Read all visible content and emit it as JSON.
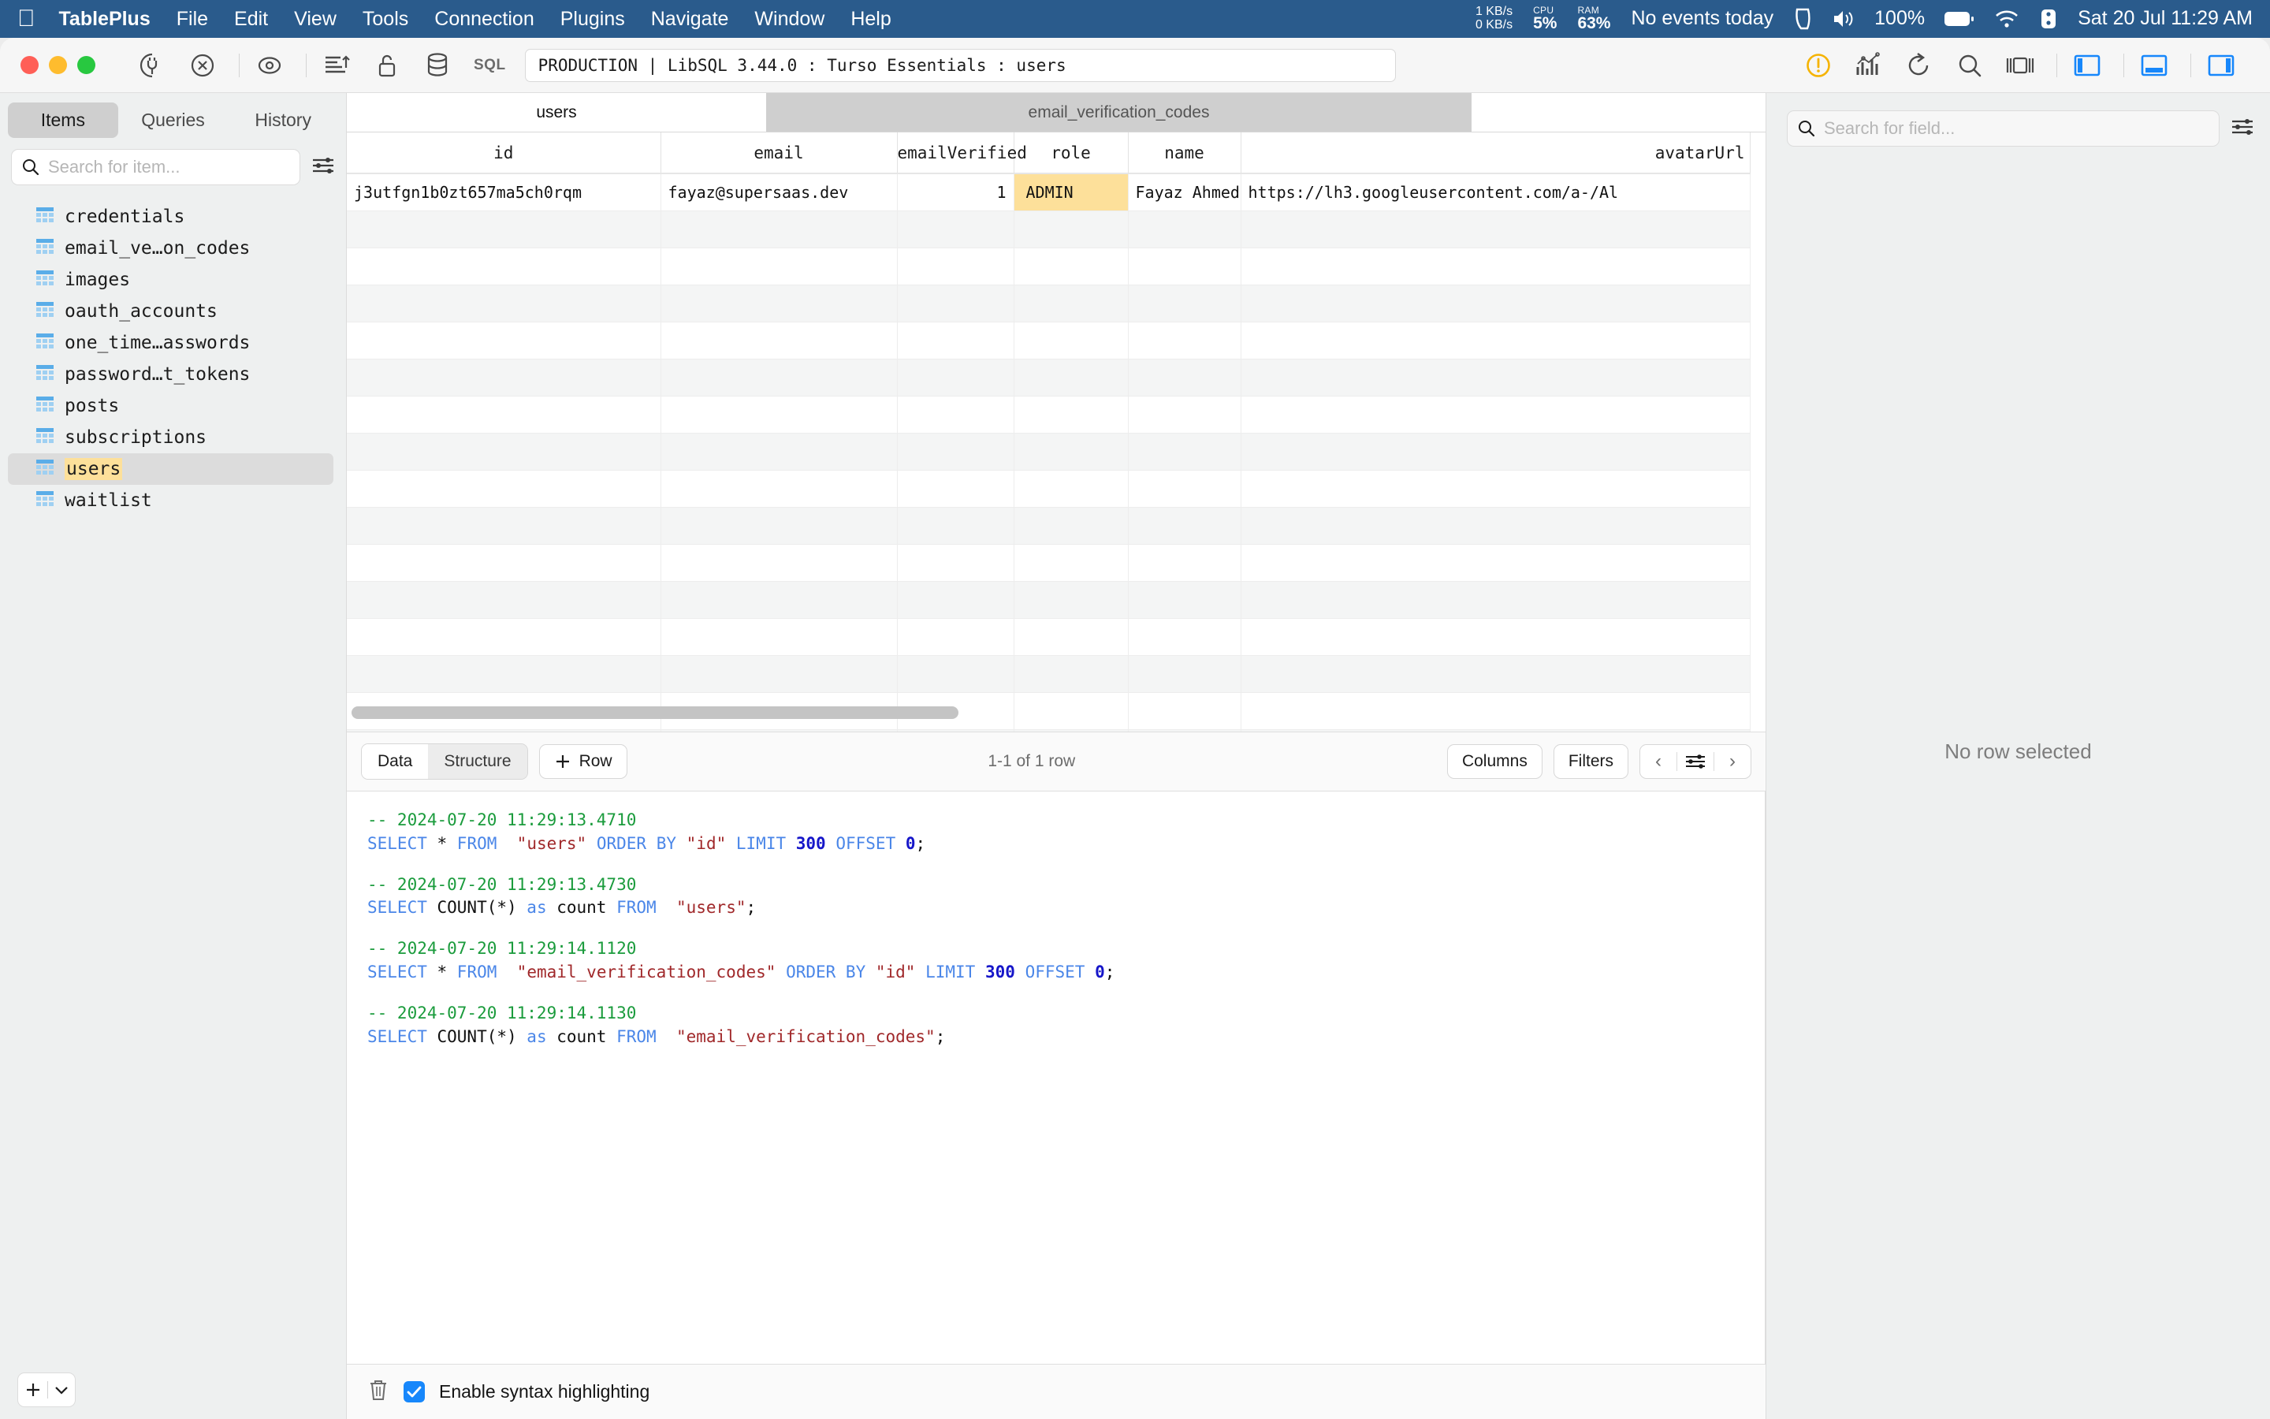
{
  "menubar": {
    "apple_icon": "apple-icon",
    "items": [
      "TablePlus",
      "File",
      "Edit",
      "View",
      "Tools",
      "Connection",
      "Plugins",
      "Navigate",
      "Window",
      "Help"
    ],
    "net_up": "1 KB/s",
    "net_down": "0 KB/s",
    "cpu_label": "CPU",
    "cpu_value": "5%",
    "ram_label": "RAM",
    "ram_value": "63%",
    "calendar": "No events today",
    "battery_percent": "100%",
    "clock": "Sat 20 Jul 11:29 AM"
  },
  "toolbar": {
    "sql_badge": "SQL",
    "connection_field": "PRODUCTION | LibSQL 3.44.0 : Turso Essentials : users",
    "icons_left": [
      "connect-plug-icon",
      "close-connection-icon",
      "eye-icon",
      "import-sort-icon",
      "lock-icon",
      "database-icon"
    ],
    "icons_right": [
      "warning-icon",
      "chart-icon",
      "refresh-icon",
      "search-icon",
      "layout-icon",
      "toggle-left-panel-icon",
      "toggle-bottom-panel-icon",
      "toggle-right-panel-icon"
    ]
  },
  "sidebar": {
    "tabs": [
      {
        "label": "Items",
        "active": true
      },
      {
        "label": "Queries",
        "active": false
      },
      {
        "label": "History",
        "active": false
      }
    ],
    "search_placeholder": "Search for item...",
    "search_value": "",
    "filter_icon": "sliders-icon",
    "items": [
      {
        "label": "credentials",
        "selected": false
      },
      {
        "label": "email_ve…on_codes",
        "selected": false
      },
      {
        "label": "images",
        "selected": false
      },
      {
        "label": "oauth_accounts",
        "selected": false
      },
      {
        "label": "one_time…asswords",
        "selected": false
      },
      {
        "label": "password…t_tokens",
        "selected": false
      },
      {
        "label": "posts",
        "selected": false
      },
      {
        "label": "subscriptions",
        "selected": false
      },
      {
        "label": "users",
        "selected": true
      },
      {
        "label": "waitlist",
        "selected": false
      }
    ],
    "add_button": "+",
    "add_dropdown_icon": "chevron-down-icon"
  },
  "data_tabs": [
    {
      "label": "users",
      "active": true
    },
    {
      "label": "email_verification_codes",
      "active": false
    }
  ],
  "grid": {
    "columns": [
      "id",
      "email",
      "emailVerified",
      "role",
      "name",
      "avatarUrl"
    ],
    "rows": [
      {
        "id": "j3utfgn1b0zt657ma5ch0rqm",
        "email": "fayaz@supersaas.dev",
        "emailVerified": "1",
        "role": "ADMIN",
        "name": "Fayaz Ahmed",
        "avatarUrl": "https://lh3.googleusercontent.com/a-/Al"
      }
    ],
    "highlight_color": "#fde09a",
    "empty_row_count": 16
  },
  "gridbar": {
    "data_label": "Data",
    "structure_label": "Structure",
    "add_row_label": "Row",
    "add_row_icon": "plus-icon",
    "row_count": "1-1 of 1 row",
    "columns_label": "Columns",
    "filters_label": "Filters",
    "prev_icon": "chevron-left-icon",
    "settings_icon": "sliders-icon",
    "next_icon": "chevron-right-icon"
  },
  "sql_log": [
    {
      "type": "comment",
      "text": "-- 2024-07-20 11:29:13.4710"
    },
    {
      "type": "sql",
      "tokens": [
        {
          "t": "SELECT",
          "c": "kw"
        },
        {
          "t": " * ",
          "c": "idt"
        },
        {
          "t": "FROM",
          "c": "kw"
        },
        {
          "t": "  ",
          "c": "idt"
        },
        {
          "t": "\"users\"",
          "c": "str"
        },
        {
          "t": " ",
          "c": "idt"
        },
        {
          "t": "ORDER BY",
          "c": "kw"
        },
        {
          "t": " ",
          "c": "idt"
        },
        {
          "t": "\"id\"",
          "c": "str"
        },
        {
          "t": " ",
          "c": "idt"
        },
        {
          "t": "LIMIT",
          "c": "kw"
        },
        {
          "t": " ",
          "c": "idt"
        },
        {
          "t": "300",
          "c": "numl"
        },
        {
          "t": " ",
          "c": "idt"
        },
        {
          "t": "OFFSET",
          "c": "kw"
        },
        {
          "t": " ",
          "c": "idt"
        },
        {
          "t": "0",
          "c": "numl"
        },
        {
          "t": ";",
          "c": "idt"
        }
      ]
    },
    {
      "type": "blank"
    },
    {
      "type": "comment",
      "text": "-- 2024-07-20 11:29:13.4730"
    },
    {
      "type": "sql",
      "tokens": [
        {
          "t": "SELECT",
          "c": "kw"
        },
        {
          "t": " COUNT(*) ",
          "c": "idt"
        },
        {
          "t": "as",
          "c": "kw"
        },
        {
          "t": " count ",
          "c": "idt"
        },
        {
          "t": "FROM",
          "c": "kw"
        },
        {
          "t": "  ",
          "c": "idt"
        },
        {
          "t": "\"users\"",
          "c": "str"
        },
        {
          "t": ";",
          "c": "idt"
        }
      ]
    },
    {
      "type": "blank"
    },
    {
      "type": "comment",
      "text": "-- 2024-07-20 11:29:14.1120"
    },
    {
      "type": "sql",
      "tokens": [
        {
          "t": "SELECT",
          "c": "kw"
        },
        {
          "t": " * ",
          "c": "idt"
        },
        {
          "t": "FROM",
          "c": "kw"
        },
        {
          "t": "  ",
          "c": "idt"
        },
        {
          "t": "\"email_verification_codes\"",
          "c": "str"
        },
        {
          "t": " ",
          "c": "idt"
        },
        {
          "t": "ORDER BY",
          "c": "kw"
        },
        {
          "t": " ",
          "c": "idt"
        },
        {
          "t": "\"id\"",
          "c": "str"
        },
        {
          "t": " ",
          "c": "idt"
        },
        {
          "t": "LIMIT",
          "c": "kw"
        },
        {
          "t": " ",
          "c": "idt"
        },
        {
          "t": "300",
          "c": "numl"
        },
        {
          "t": " ",
          "c": "idt"
        },
        {
          "t": "OFFSET",
          "c": "kw"
        },
        {
          "t": " ",
          "c": "idt"
        },
        {
          "t": "0",
          "c": "numl"
        },
        {
          "t": ";",
          "c": "idt"
        }
      ]
    },
    {
      "type": "blank"
    },
    {
      "type": "comment",
      "text": "-- 2024-07-20 11:29:14.1130"
    },
    {
      "type": "sql",
      "tokens": [
        {
          "t": "SELECT",
          "c": "kw"
        },
        {
          "t": " COUNT(*) ",
          "c": "idt"
        },
        {
          "t": "as",
          "c": "kw"
        },
        {
          "t": " count ",
          "c": "idt"
        },
        {
          "t": "FROM",
          "c": "kw"
        },
        {
          "t": "  ",
          "c": "idt"
        },
        {
          "t": "\"email_verification_codes\"",
          "c": "str"
        },
        {
          "t": ";",
          "c": "idt"
        }
      ]
    }
  ],
  "statusbar": {
    "trash_icon": "trash-icon",
    "checkbox_checked": true,
    "checkbox_label": "Enable syntax highlighting"
  },
  "right_panel": {
    "search_placeholder": "Search for field...",
    "filter_icon": "sliders-icon",
    "empty_message": "No row selected"
  },
  "colors": {
    "menubar_bg": "#2a5b8c",
    "accent_blue": "#1787fb",
    "highlight_yellow": "#fde09a",
    "warning_yellow": "#f5b301"
  }
}
